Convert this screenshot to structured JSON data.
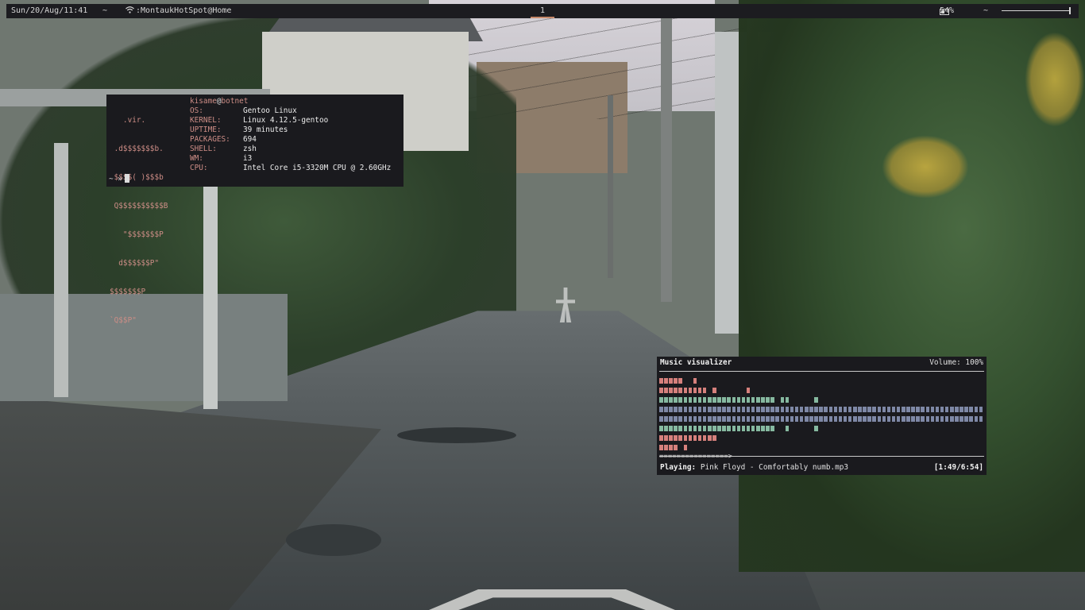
{
  "topbar": {
    "date": "Sun/20/Aug/11:41",
    "separator_left": "~",
    "wifi_network": "MontaukHotSpot@Home",
    "workspace": "1",
    "battery": "54%",
    "separator_right": "~"
  },
  "terminal": {
    "ascii_logo": [
      "   .vir.",
      " .d$$$$$$$b.",
      " $$$$( )$$$b",
      " Q$$$$$$$$$$B",
      "   \"$$$$$$$P",
      "  d$$$$$$P\"",
      "$$$$$$$P",
      "`Q$$P\""
    ],
    "user": "kisame",
    "at": "@",
    "host": "botnet",
    "info": [
      {
        "key": "OS:",
        "value": "Gentoo Linux"
      },
      {
        "key": "KERNEL:",
        "value": "Linux 4.12.5-gentoo"
      },
      {
        "key": "UPTIME:",
        "value": "39 minutes"
      },
      {
        "key": "PACKAGES:",
        "value": "694"
      },
      {
        "key": "SHELL:",
        "value": "zsh"
      },
      {
        "key": "WM:",
        "value": "i3"
      },
      {
        "key": "CPU:",
        "value": "Intel Core i5-3320M CPU @ 2.60GHz"
      }
    ],
    "prompt": "~ »"
  },
  "visualizer": {
    "title": "Music visualizer",
    "volume": "Volume: 100%",
    "progress_bar": "================>",
    "playing_label": "Playing:",
    "track": "Pink Floyd - Comfortably numb.mp3",
    "time": "[1:49/6:54]",
    "colors": {
      "red": "#d6807c",
      "green": "#86b9a0",
      "blue": "#7e88a6"
    },
    "bars": [
      {
        "color": "red",
        "segments": [
          [
            0,
            5
          ],
          [
            7,
            1
          ]
        ]
      },
      {
        "color": "red",
        "segments": [
          [
            0,
            10
          ],
          [
            11,
            1
          ],
          [
            18,
            1
          ]
        ]
      },
      {
        "color": "green",
        "segments": [
          [
            0,
            24
          ],
          [
            25,
            2
          ],
          [
            32,
            1
          ]
        ]
      },
      {
        "color": "blue",
        "segments": [
          [
            0,
            67
          ]
        ]
      },
      {
        "color": "blue",
        "segments": [
          [
            0,
            67
          ]
        ]
      },
      {
        "color": "green",
        "segments": [
          [
            0,
            22
          ],
          [
            22,
            2
          ],
          [
            26,
            1
          ],
          [
            32,
            1
          ]
        ]
      },
      {
        "color": "red",
        "segments": [
          [
            0,
            12
          ]
        ]
      },
      {
        "color": "red",
        "segments": [
          [
            0,
            4
          ],
          [
            5,
            1
          ]
        ]
      }
    ]
  }
}
